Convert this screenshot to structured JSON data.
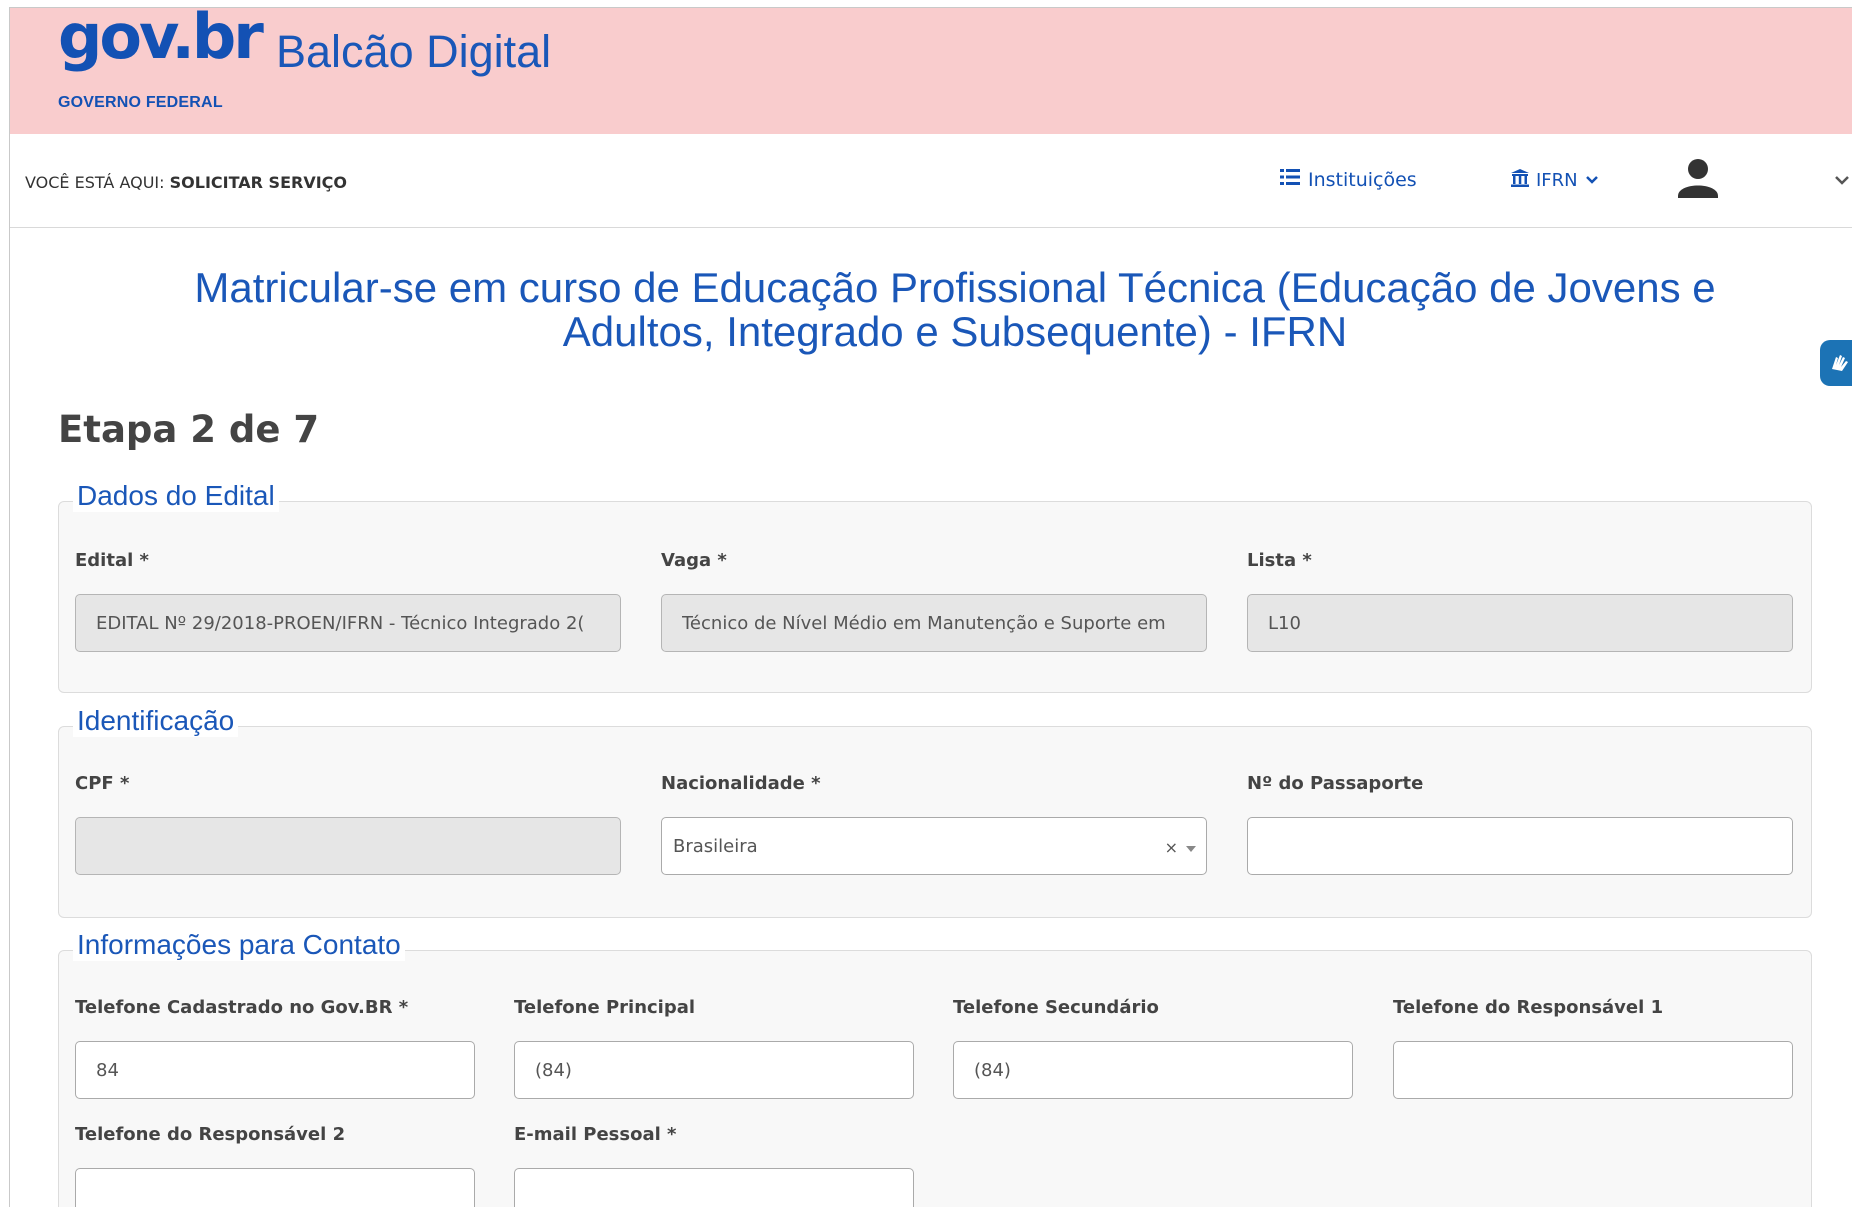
{
  "header": {
    "logo_text": "gov.br",
    "logo_sub": "GOVERNO FEDERAL",
    "app_title": "Balcão Digital",
    "bg_color": "#f9cccd"
  },
  "breadcrumb": {
    "prefix": "VOCÊ ESTÁ AQUI: ",
    "current": "SOLICITAR SERVIÇO"
  },
  "nav": {
    "institutions_label": "Instituições",
    "institutions_icon": "list-icon",
    "org_label": "IFRN",
    "org_icon": "bank-icon",
    "user_icon": "user-avatar-icon"
  },
  "page": {
    "title_line1": "Matricular-se em curso de Educação Profissional Técnica (Educação de Jovens e",
    "title_line2": "Adultos, Integrado e Subsequente) - IFRN",
    "step": "Etapa 2 de 7"
  },
  "sections": {
    "edital": {
      "legend": "Dados do Edital",
      "edital_label": "Edital *",
      "edital_value": "EDITAL Nº 29/2018-PROEN/IFRN - Técnico Integrado 2(",
      "vaga_label": "Vaga *",
      "vaga_value": "Técnico de Nível Médio em Manutenção e Suporte em",
      "lista_label": "Lista *",
      "lista_value": "L10"
    },
    "identificacao": {
      "legend": "Identificação",
      "cpf_label": "CPF *",
      "cpf_value": "",
      "nacionalidade_label": "Nacionalidade *",
      "nacionalidade_value": "Brasileira",
      "clear_symbol": "×",
      "passaporte_label": "Nº do Passaporte",
      "passaporte_value": ""
    },
    "contato": {
      "legend": "Informações para Contato",
      "tel_govbr_label": "Telefone Cadastrado no Gov.BR *",
      "tel_govbr_value": "84",
      "tel_principal_label": "Telefone Principal",
      "tel_principal_value": "(84)",
      "tel_secundario_label": "Telefone Secundário",
      "tel_secundario_value": "(84)",
      "tel_resp1_label": "Telefone do Responsável 1",
      "tel_resp1_value": "",
      "tel_resp2_label": "Telefone do Responsável 2",
      "tel_resp2_value": "",
      "email_label": "E-mail Pessoal *",
      "email_value": ""
    }
  },
  "accessibility": {
    "vlibras_icon": "vlibras-hands-icon"
  }
}
